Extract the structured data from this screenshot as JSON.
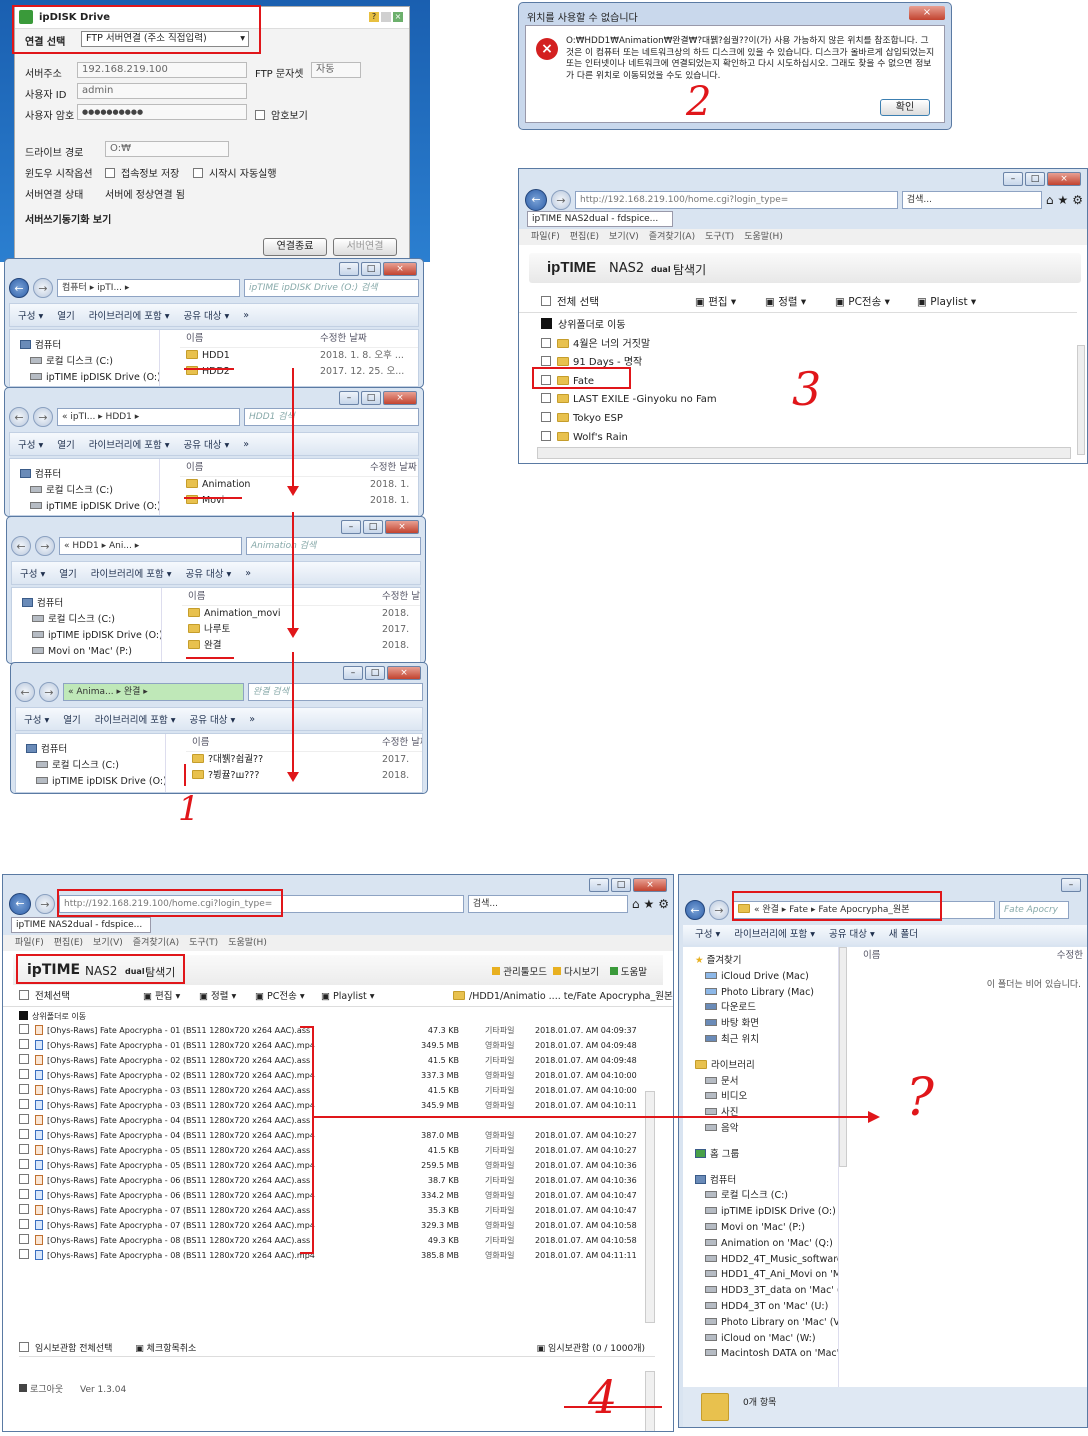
{
  "ipdisk": {
    "title": "ipDISK Drive",
    "conn_label": "연결 선택",
    "conn_value": "FTP 서버연결 (주소 직접입력)",
    "server_label": "서버주소",
    "server_value": "192.168.219.100",
    "charset_label": "FTP 문자셋",
    "charset_value": "자동",
    "user_label": "사용자 ID",
    "user_value": "admin",
    "pw_label": "사용자 암호",
    "pw_value": "●●●●●●●●●●",
    "showpw_label": "암호보기",
    "drive_label": "드라이브 경로",
    "drive_value": "O:₩",
    "startup_label": "윈도우 시작옵션",
    "save_label": "접속정보 저장",
    "auto_label": "시작시 자동실행",
    "status_label": "서버연결 상태",
    "status_value": "서버에 정상연결 됨",
    "sync_label": "서버쓰기동기화 보기",
    "disconnect_btn": "연결종료",
    "connect_btn": "서버연결"
  },
  "error_dialog": {
    "title": "위치를 사용할 수 없습니다",
    "message": "O:₩HDD1₩Animation₩완결₩?대뷁?쉽궐??이(가) 사용 가능하지 않은 위치를 참조합니다. 그것은 이 컴퓨터 또는 네트워크상의 하드 디스크에 있을 수 있습니다. 디스크가 올바르게 삽입되었는지 또는 인터넷이나 네트워크에 연결되었는지 확인하고 다시 시도하십시오. 그래도 찾을 수 없으면 정보가 다른 위치로 이동되었을 수도 있습니다.",
    "ok": "확인"
  },
  "annot": {
    "n1": "1",
    "n2": "2",
    "n3": "3",
    "n4": "4",
    "q": "?"
  },
  "explorers": [
    {
      "addr": "컴퓨터 ▸ ipTI... ▸",
      "search": "ipTIME ipDISK Drive (O:) 검색",
      "nav": [
        "컴퓨터",
        "로컬 디스크 (C:)",
        "ipTIME ipDISK Drive (O:)"
      ],
      "files": [
        {
          "name": "HDD1",
          "date": "2018. 1. 8. 오후 ..."
        },
        {
          "name": "HDD2",
          "date": "2017. 12. 25. 오..."
        }
      ]
    },
    {
      "addr": "« ipTI... ▸ HDD1 ▸",
      "search": "HDD1 검색",
      "nav": [
        "컴퓨터",
        "로컬 디스크 (C:)",
        "ipTIME ipDISK Drive (O:)"
      ],
      "files": [
        {
          "name": "Animation",
          "date": "2018. 1."
        },
        {
          "name": "Movi",
          "date": "2018. 1."
        }
      ]
    },
    {
      "addr": "« HDD1 ▸ Ani... ▸",
      "search": "Animation 검색",
      "nav": [
        "컴퓨터",
        "로컬 디스크 (C:)",
        "ipTIME ipDISK Drive (O:)",
        "Movi on 'Mac' (P:)"
      ],
      "files": [
        {
          "name": "Animation_movi",
          "date": "2018."
        },
        {
          "name": "나루토",
          "date": "2017."
        },
        {
          "name": "완결",
          "date": "2018."
        }
      ]
    },
    {
      "addr": "« Anima... ▸ 완결 ▸",
      "search": "완결 검색",
      "nav": [
        "컴퓨터",
        "로컬 디스크 (C:)",
        "ipTIME ipDISK Drive (O:)"
      ],
      "files": [
        {
          "name": "?대뷁?쉽궐??",
          "date": "2017."
        },
        {
          "name": "?뷩뀰?ш???",
          "date": "2018."
        }
      ]
    }
  ],
  "explorer_toolbar": {
    "organize": "구성 ▾",
    "open": "열기",
    "library": "라이브러리에 포함 ▾",
    "share": "공유 대상 ▾",
    "more": "»",
    "col_name": "이름",
    "col_date": "수정한 날짜"
  },
  "browser_small": {
    "url": "http://192.168.219.100/home.cgi?login_type=",
    "search": "검색...",
    "tab": "ipTIME NAS2dual - fdspice...",
    "menu": [
      "파일(F)",
      "편집(E)",
      "보기(V)",
      "즐겨찾기(A)",
      "도구(T)",
      "도움말(H)"
    ],
    "brand": "ipTIME",
    "model": "NAS2",
    "dual": "dual",
    "title": "탐색기",
    "selectall": "전체 선택",
    "edit": "편집",
    "sort": "정렬",
    "pcsend": "PC전송",
    "playlist": "Playlist",
    "up": "상위폴더로 이동",
    "folders": [
      "4월은 너의 거짓말",
      "91 Days - 명작",
      "Fate",
      "LAST EXILE -Ginyoku no Fam",
      "Tokyo ESP",
      "Wolf's Rain"
    ]
  },
  "browser_big": {
    "url": "http://192.168.219.100/home.cgi?login_type=",
    "search": "검색...",
    "tab": "ipTIME NAS2dual - fdspice...",
    "menu": [
      "파일(F)",
      "편집(E)",
      "보기(V)",
      "즐겨찾기(A)",
      "도구(T)",
      "도움말(H)"
    ],
    "brand": "ipTIME",
    "model": "NAS2",
    "dual": "dual",
    "title": "탐색기",
    "admin": "관리툴모드",
    "refresh": "다시보기",
    "help": "도움말",
    "selectall": "전체선택",
    "edit": "편집",
    "sort": "정렬",
    "pcsend": "PC전송",
    "playlist": "Playlist",
    "path": "/HDD1/Animatio .... te/Fate Apocrypha_원본",
    "up": "상위폴더로 이동",
    "files": [
      {
        "name": "[Ohys-Raws] Fate Apocrypha - 01 (BS11 1280x720 x264 AAC).ass",
        "size": "47.3 KB",
        "type": "기타파일",
        "date": "2018.01.07. AM 04:09:37"
      },
      {
        "name": "[Ohys-Raws] Fate Apocrypha - 01 (BS11 1280x720 x264 AAC).mp4",
        "size": "349.5 MB",
        "type": "영화파일",
        "date": "2018.01.07. AM 04:09:48"
      },
      {
        "name": "[Ohys-Raws] Fate Apocrypha - 02 (BS11 1280x720 x264 AAC).ass",
        "size": "41.5 KB",
        "type": "기타파일",
        "date": "2018.01.07. AM 04:09:48"
      },
      {
        "name": "[Ohys-Raws] Fate Apocrypha - 02 (BS11 1280x720 x264 AAC).mp4",
        "size": "337.3 MB",
        "type": "영화파일",
        "date": "2018.01.07. AM 04:10:00"
      },
      {
        "name": "[Ohys-Raws] Fate Apocrypha - 03 (BS11 1280x720 x264 AAC).ass",
        "size": "41.5 KB",
        "type": "기타파일",
        "date": "2018.01.07. AM 04:10:00"
      },
      {
        "name": "[Ohys-Raws] Fate Apocrypha - 03 (BS11 1280x720 x264 AAC).mp4",
        "size": "345.9 MB",
        "type": "영화파일",
        "date": "2018.01.07. AM 04:10:11"
      },
      {
        "name": "[Ohys-Raws] Fate Apocrypha - 04 (BS11 1280x720 x264 AAC).ass",
        "size": "",
        "type": "",
        "date": ""
      },
      {
        "name": "[Ohys-Raws] Fate Apocrypha - 04 (BS11 1280x720 x264 AAC).mp4",
        "size": "387.0 MB",
        "type": "영화파일",
        "date": "2018.01.07. AM 04:10:27"
      },
      {
        "name": "[Ohys-Raws] Fate Apocrypha - 05 (BS11 1280x720 x264 AAC).ass",
        "size": "41.5 KB",
        "type": "기타파일",
        "date": "2018.01.07. AM 04:10:27"
      },
      {
        "name": "[Ohys-Raws] Fate Apocrypha - 05 (BS11 1280x720 x264 AAC).mp4",
        "size": "259.5 MB",
        "type": "영화파일",
        "date": "2018.01.07. AM 04:10:36"
      },
      {
        "name": "[Ohys-Raws] Fate Apocrypha - 06 (BS11 1280x720 x264 AAC).ass",
        "size": "38.7 KB",
        "type": "기타파일",
        "date": "2018.01.07. AM 04:10:36"
      },
      {
        "name": "[Ohys-Raws] Fate Apocrypha - 06 (BS11 1280x720 x264 AAC).mp4",
        "size": "334.2 MB",
        "type": "영화파일",
        "date": "2018.01.07. AM 04:10:47"
      },
      {
        "name": "[Ohys-Raws] Fate Apocrypha - 07 (BS11 1280x720 x264 AAC).ass",
        "size": "35.3 KB",
        "type": "기타파일",
        "date": "2018.01.07. AM 04:10:47"
      },
      {
        "name": "[Ohys-Raws] Fate Apocrypha - 07 (BS11 1280x720 x264 AAC).mp4",
        "size": "329.3 MB",
        "type": "영화파일",
        "date": "2018.01.07. AM 04:10:58"
      },
      {
        "name": "[Ohys-Raws] Fate Apocrypha - 08 (BS11 1280x720 x264 AAC).ass",
        "size": "49.3 KB",
        "type": "기타파일",
        "date": "2018.01.07. AM 04:10:58"
      },
      {
        "name": "[Ohys-Raws] Fate Apocrypha - 08 (BS11 1280x720 x264 AAC).mp4",
        "size": "385.8 MB",
        "type": "영화파일",
        "date": "2018.01.07. AM 04:11:11"
      }
    ],
    "temp_selectall": "임시보관함 전체선택",
    "uncheck": "체크항목취소",
    "temp_box": "임시보관함 (0 / 1000개)",
    "logout": "로그아웃",
    "version": "Ver 1.3.04"
  },
  "explorer_right": {
    "addr": "« 완결 ▸ Fate ▸ Fate Apocrypha_원본",
    "search": "Fate Apocry",
    "organize": "구성 ▾",
    "library": "라이브러리에 포함 ▾",
    "share": "공유 대상 ▾",
    "newfolder": "새 폴더",
    "col_name": "이름",
    "col_date": "수정한",
    "empty": "이 폴더는 비어 있습니다.",
    "favorites": "즐겨찾기",
    "fav_items": [
      "iCloud Drive (Mac)",
      "Photo Library (Mac)",
      "다운로드",
      "바탕 화면",
      "최근 위치"
    ],
    "libraries": "라이브러리",
    "lib_items": [
      "문서",
      "비디오",
      "사진",
      "음악"
    ],
    "homegroup": "홈 그룹",
    "computer": "컴퓨터",
    "comp_items": [
      "로컬 디스크 (C:)",
      "ipTIME ipDISK Drive (O:)",
      "Movi on 'Mac' (P:)",
      "Animation on 'Mac' (Q:)",
      "HDD2_4T_Music_software o",
      "HDD1_4T_Ani_Movi on 'Ma",
      "HDD3_3T_data on 'Mac' (T:",
      "HDD4_3T on 'Mac' (U:)",
      "Photo Library on 'Mac' (V:)",
      "iCloud on 'Mac' (W:)",
      "Macintosh DATA on 'Mac' ("
    ],
    "count": "0개 항목"
  }
}
